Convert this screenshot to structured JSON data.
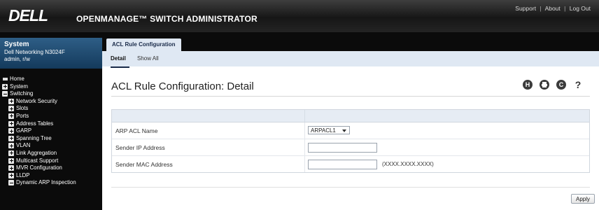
{
  "header": {
    "logo": "DELL",
    "app_title": "OPENMANAGE™ SWITCH ADMINISTRATOR",
    "links": [
      "Support",
      "About",
      "Log Out"
    ],
    "separator": "|"
  },
  "system": {
    "title": "System",
    "model": "Dell Networking N3024F",
    "user": "admin, r/w"
  },
  "nav": [
    {
      "label": "Home",
      "icon": "home-icon",
      "level": 0
    },
    {
      "label": "System",
      "icon": "expand-plus-icon",
      "level": 0
    },
    {
      "label": "Switching",
      "icon": "collapse-minus-icon",
      "level": 0
    },
    {
      "label": "Network Security",
      "icon": "expand-plus-icon",
      "level": 1
    },
    {
      "label": "Slots",
      "icon": "expand-plus-icon",
      "level": 1
    },
    {
      "label": "Ports",
      "icon": "expand-plus-icon",
      "level": 1
    },
    {
      "label": "Address Tables",
      "icon": "expand-plus-icon",
      "level": 1
    },
    {
      "label": "GARP",
      "icon": "expand-plus-icon",
      "level": 1
    },
    {
      "label": "Spanning Tree",
      "icon": "expand-plus-icon",
      "level": 1
    },
    {
      "label": "VLAN",
      "icon": "expand-plus-icon",
      "level": 1
    },
    {
      "label": "Link Aggregation",
      "icon": "expand-plus-icon",
      "level": 1
    },
    {
      "label": "Multicast Support",
      "icon": "expand-plus-icon",
      "level": 1
    },
    {
      "label": "MVR Configuration",
      "icon": "expand-plus-icon",
      "level": 1
    },
    {
      "label": "LLDP",
      "icon": "expand-plus-icon",
      "level": 1
    },
    {
      "label": "Dynamic ARP Inspection",
      "icon": "collapse-minus-icon",
      "level": 1
    }
  ],
  "tab": {
    "label": "ACL Rule Configuration"
  },
  "subtabs": [
    {
      "label": "Detail",
      "active": true
    },
    {
      "label": "Show All",
      "active": false
    }
  ],
  "page_title": "ACL Rule Configuration: Detail",
  "toolbar": {
    "save_glyph": "H",
    "refresh_glyph": "C",
    "help_glyph": "?"
  },
  "form": {
    "arp_acl_name_label": "ARP ACL Name",
    "arp_acl_name_value": "ARPACL1",
    "sender_ip_label": "Sender IP Address",
    "sender_ip_value": "",
    "sender_mac_label": "Sender MAC Address",
    "sender_mac_value": "",
    "sender_mac_hint": "(XXXX.XXXX.XXXX)"
  },
  "apply_label": "Apply",
  "colors": {
    "header_bg": "#161616",
    "system_box": "#1f4a70",
    "tab_bg": "#dfe8f3",
    "accent": "#1a2b4a"
  }
}
